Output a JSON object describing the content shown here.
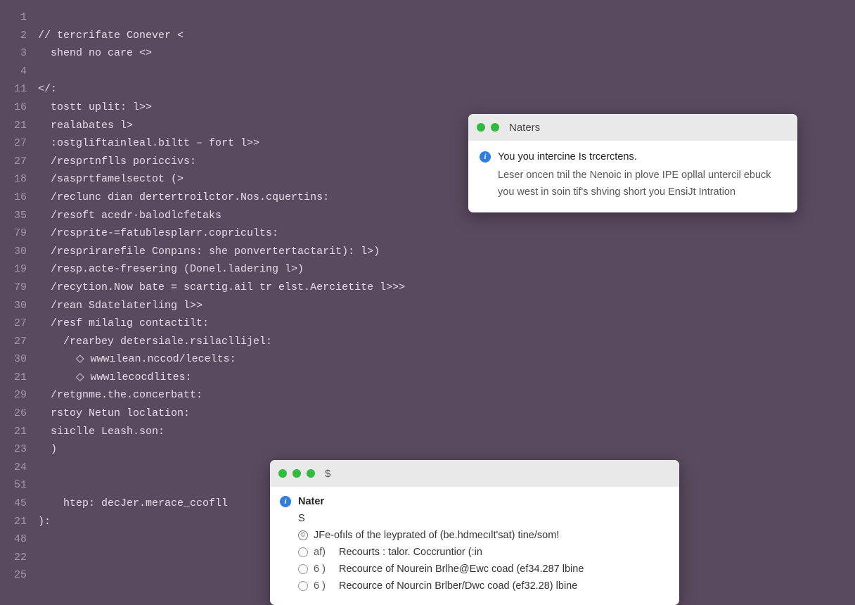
{
  "colors": {
    "editor_bg": "#5a4a5f",
    "gutter": "#a598aa",
    "code": "#e6dce8",
    "popup_titlebar": "#e9e9e9",
    "info_icon": "#2f7de1",
    "traffic_green": "#2fbb3c",
    "traffic_yellow": "#f6bd3b",
    "traffic_red": "#ff5f57"
  },
  "editor": {
    "lines": [
      {
        "num": "1",
        "text": ""
      },
      {
        "num": "2",
        "text": "// tercrifate Conever <"
      },
      {
        "num": "3",
        "text": "  shend no care <>"
      },
      {
        "num": "4",
        "text": ""
      },
      {
        "num": "11",
        "text": "</:"
      },
      {
        "num": "16",
        "text": "  tostt uplit: l>>"
      },
      {
        "num": "21",
        "text": "  realabates l>"
      },
      {
        "num": "27",
        "text": "  :ostgliftainleal.biltt – fort l>>"
      },
      {
        "num": "27",
        "text": "  /resprtnflls poriccivs:"
      },
      {
        "num": "18",
        "text": "  /sasprtfamelsectot (>"
      },
      {
        "num": "16",
        "text": "  /reclunc dian dertertroilctor.Nos.cquertins:"
      },
      {
        "num": "35",
        "text": "  /resoft acedr·balodlcfetaks"
      },
      {
        "num": "79",
        "text": "  /rcsprite-=fatublesplarr.copricults:"
      },
      {
        "num": "30",
        "text": "  /resprirarefile Conpıns: she ponvertertactarit): l>)"
      },
      {
        "num": "19",
        "text": "  /resp.acte-fresering (Donel.ladering l>)"
      },
      {
        "num": "79",
        "text": "  /recytion.Now bate = scartig.ail tr elst.Aercietite l>>>"
      },
      {
        "num": "30",
        "text": "  /rean Sdatelaterling l>>"
      },
      {
        "num": "27",
        "text": "  /resf milalıg contactilt:"
      },
      {
        "num": "27",
        "text": "    /rearbey detersiale.rsilacllijel:"
      },
      {
        "num": "30",
        "text": "      ◇ wwwılean.nccod/lecelts:"
      },
      {
        "num": "21",
        "text": "      ◇ wwwılecocdlites:"
      },
      {
        "num": "",
        "text": ""
      },
      {
        "num": "29",
        "text": "  /retgnme.the.concerbatt:"
      },
      {
        "num": "26",
        "text": "  rstoy Netun loclation:"
      },
      {
        "num": "21",
        "text": "  siıclle Leash.son:"
      },
      {
        "num": "23",
        "text": "  )"
      },
      {
        "num": "24",
        "text": ""
      },
      {
        "num": "51",
        "text": ""
      },
      {
        "num": "45",
        "text": "    htep: decJer.merace_ccofll"
      },
      {
        "num": "21",
        "text": "):"
      },
      {
        "num": "48",
        "text": ""
      },
      {
        "num": "22",
        "text": ""
      },
      {
        "num": "25",
        "text": ""
      }
    ]
  },
  "popup1": {
    "title": "Naters",
    "line1": "You you intercine Is trcerctens.",
    "line2": "Leser oncen tnil the Nenoic in plove IPE opllal untercil ebuck you west in soin tif's  shving short you EnsiJt Intration"
  },
  "popup2": {
    "prompt": "$",
    "heading": "Nater",
    "sub": "S",
    "rows": [
      {
        "mark": "©",
        "num": "",
        "text": "JFe-ofıls of the leyprated of (be.hdmecılt'sat) tine/som!"
      },
      {
        "mark": "",
        "num": "af)",
        "text": "Recourts : talor. Coccruntior (:in"
      },
      {
        "mark": "",
        "num": "6 )",
        "text": "Recource of Nourein Brlhe@Ewc coad (ef34.287 lbine"
      },
      {
        "mark": "",
        "num": "6 )",
        "text": "Recource of Nourcin Brlber/Dwc coad (ef32.28) lbine"
      }
    ]
  }
}
